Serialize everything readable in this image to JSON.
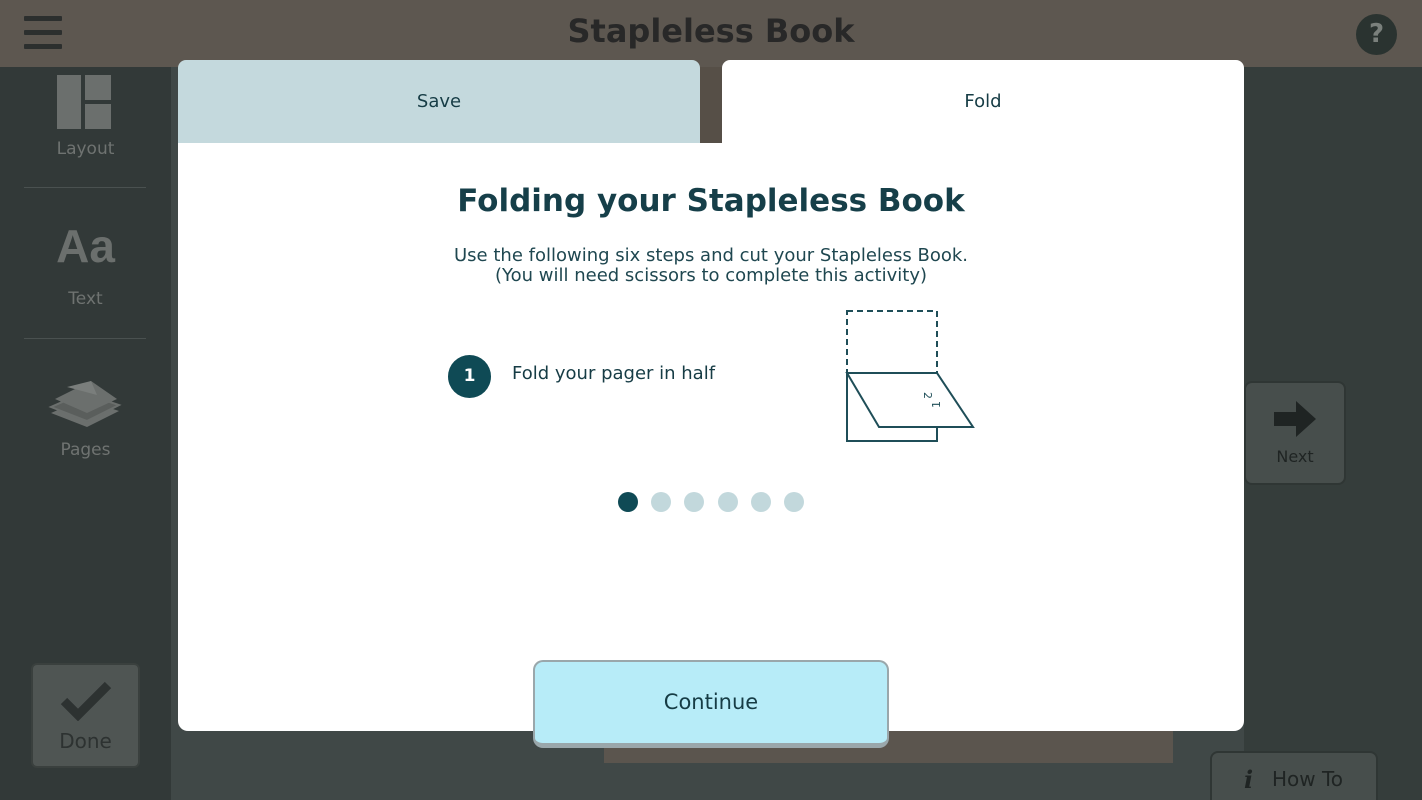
{
  "header": {
    "title": "Stapleless Book",
    "menu_icon": "hamburger-menu-icon",
    "help_label": "?"
  },
  "sidebar": {
    "items": [
      {
        "label": "Layout",
        "icon": "layout-icon"
      },
      {
        "label": "Text",
        "icon_text": "Aa"
      },
      {
        "label": "Pages",
        "icon": "pages-stack-icon"
      }
    ],
    "done_label": "Done"
  },
  "canvas": {
    "next_label": "Next",
    "howto_icon": "i",
    "howto_label": "How To"
  },
  "modal": {
    "tabs": [
      {
        "label": "Save",
        "active": false
      },
      {
        "label": "Fold",
        "active": true
      }
    ],
    "title": "Folding your Stapleless Book",
    "description_line1": "Use the following six steps and cut your Stapleless Book.",
    "description_line2": "(You will need scissors to complete this activity)",
    "step": {
      "number": "1",
      "text": "Fold your pager in half"
    },
    "pagination": {
      "total": 6,
      "current": 1
    },
    "continue_label": "Continue"
  },
  "colors": {
    "accent": "#0f4a55",
    "inactive_tab": "#c4d9dd",
    "continue_bg": "#b7ecf8",
    "dot_inactive": "#c2d8dc"
  }
}
